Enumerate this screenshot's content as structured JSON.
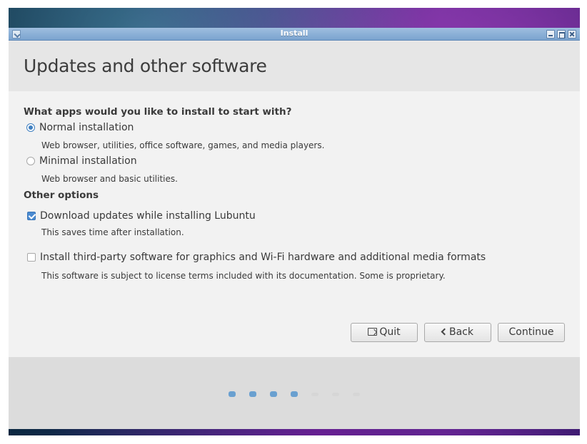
{
  "window": {
    "title": "Install"
  },
  "header": {
    "title": "Updates and other software"
  },
  "apps_section": {
    "question": "What apps would you like to install to start with?",
    "options": [
      {
        "label": "Normal installation",
        "description": "Web browser, utilities, office software, games, and media players.",
        "selected": true
      },
      {
        "label": "Minimal installation",
        "description": "Web browser and basic utilities.",
        "selected": false
      }
    ]
  },
  "other_section": {
    "title": "Other options",
    "options": [
      {
        "label": "Download updates while installing Lubuntu",
        "description": "This saves time after installation.",
        "checked": true
      },
      {
        "label": "Install third-party software for graphics and Wi-Fi hardware and additional media formats",
        "description": "This software is subject to license terms included with its documentation. Some is proprietary.",
        "checked": false
      }
    ]
  },
  "buttons": {
    "quit": "Quit",
    "back": "Back",
    "continue": "Continue"
  },
  "progress": {
    "total_steps": 7,
    "completed_steps": 4
  },
  "colors": {
    "accent": "#3f7fc0",
    "titlebar": "#7aa3cf"
  }
}
